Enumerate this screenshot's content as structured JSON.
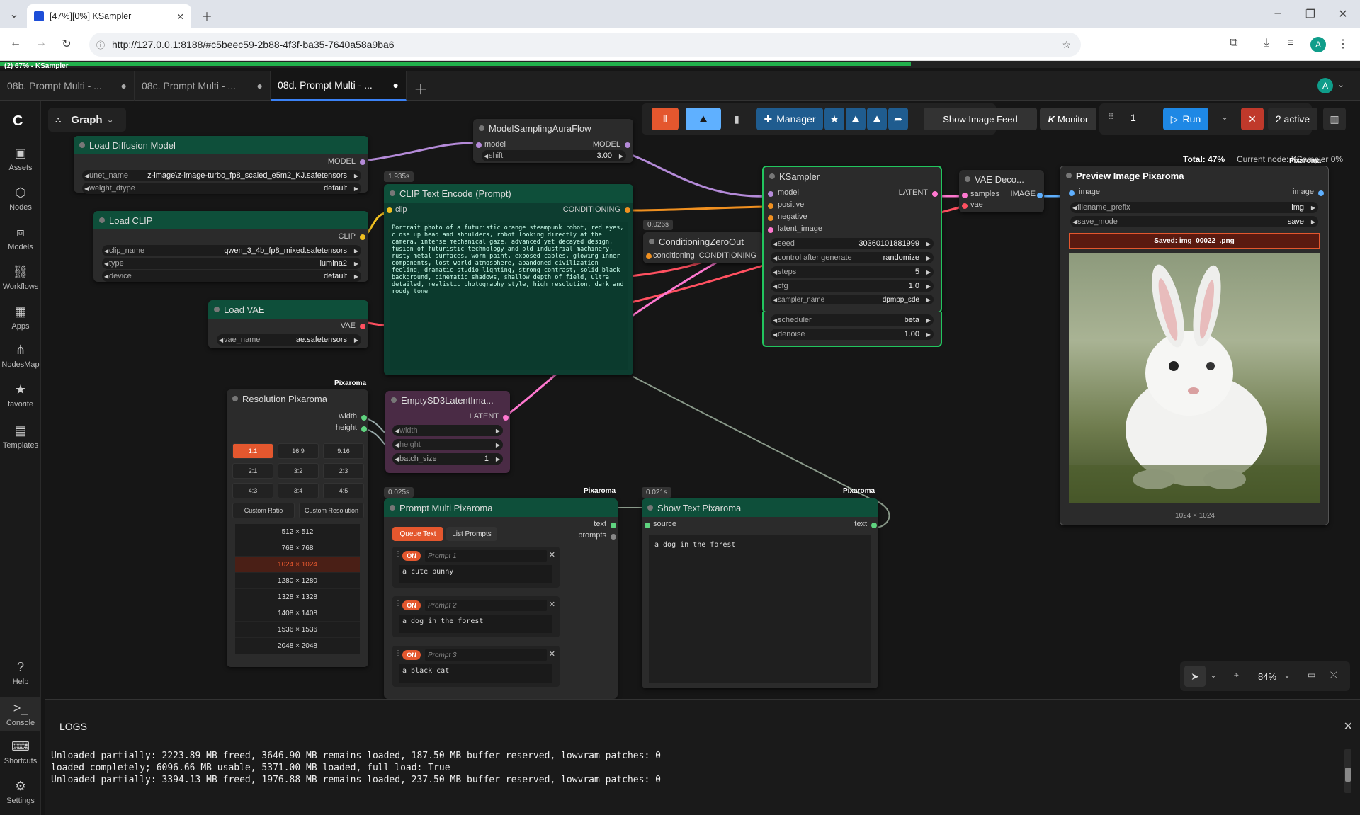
{
  "browser": {
    "tab_title": "[47%][0%] KSampler",
    "url": "http://127.0.0.1:8188/#c5beec59-2b88-4f3f-ba35-7640a58a9ba6",
    "profile_initial": "A"
  },
  "progress": {
    "label": "(2) 67% - KSampler",
    "fraction": 0.67
  },
  "workflow_tabs": [
    {
      "label": "08b. Prompt Multi - ...",
      "active": false
    },
    {
      "label": "08c. Prompt Multi - ...",
      "active": false
    },
    {
      "label": "08d. Prompt Multi - ...",
      "active": true
    }
  ],
  "sidebar": {
    "items": [
      {
        "label": "Assets",
        "icon": "assets-icon"
      },
      {
        "label": "Nodes",
        "icon": "nodes-icon"
      },
      {
        "label": "Models",
        "icon": "models-icon"
      },
      {
        "label": "Workflows",
        "icon": "workflows-icon"
      },
      {
        "label": "Apps",
        "icon": "apps-icon"
      },
      {
        "label": "NodesMap",
        "icon": "nodesmap-icon"
      },
      {
        "label": "favorite",
        "icon": "star-icon"
      },
      {
        "label": "Templates",
        "icon": "templates-icon"
      }
    ],
    "bottom": [
      {
        "label": "Help",
        "icon": "help-icon"
      },
      {
        "label": "Console",
        "icon": "console-icon"
      },
      {
        "label": "Shortcuts",
        "icon": "keyboard-icon"
      },
      {
        "label": "Settings",
        "icon": "gear-icon"
      }
    ]
  },
  "graph_menu": {
    "label": "Graph"
  },
  "toolbar": {
    "manager": "Manager",
    "show_feed": "Show Image Feed",
    "monitor": "Monitor",
    "queue_count": "1",
    "run": "Run",
    "active": "2 active",
    "total": "Total: 47%",
    "current": "Current node: KSampler 0%",
    "user_initial": "A"
  },
  "nodes": {
    "load_diffusion": {
      "title": "Load Diffusion Model",
      "out": "MODEL",
      "unet_label": "unet_name",
      "unet_value": "z-image\\z-image-turbo_fp8_scaled_e5m2_KJ.safetensors",
      "dtype_label": "weight_dtype",
      "dtype_value": "default"
    },
    "load_clip": {
      "title": "Load CLIP",
      "out": "CLIP",
      "clip_label": "clip_name",
      "clip_value": "qwen_3_4b_fp8_mixed.safetensors",
      "type_label": "type",
      "type_value": "lumina2",
      "device_label": "device",
      "device_value": "default"
    },
    "load_vae": {
      "title": "Load VAE",
      "out": "VAE",
      "vae_label": "vae_name",
      "vae_value": "ae.safetensors"
    },
    "model_sampling": {
      "title": "ModelSamplingAuraFlow",
      "in": "model",
      "out": "MODEL",
      "shift_label": "shift",
      "shift_value": "3.00"
    },
    "clip_encode": {
      "title": "CLIP Text Encode (Prompt)",
      "timing": "1.935s",
      "in": "clip",
      "out": "CONDITIONING",
      "text": "Portrait photo of a futuristic orange steampunk robot, red eyes, close up head and shoulders, robot looking directly at the camera, intense mechanical gaze, advanced yet decayed design, fusion of futuristic technology and old industrial machinery, rusty metal surfaces, worn paint, exposed cables, glowing inner components, lost world atmosphere, abandoned civilization feeling, dramatic studio lighting, strong contrast, solid black background, cinematic shadows, shallow depth of field, ultra detailed, realistic photography style, high resolution, dark and moody tone"
    },
    "cond_zero": {
      "title": "ConditioningZeroOut",
      "timing": "0.026s",
      "in": "conditioning",
      "out": "CONDITIONING"
    },
    "ksampler": {
      "title": "KSampler",
      "inputs": [
        "model",
        "positive",
        "negative",
        "latent_image"
      ],
      "out": "LATENT",
      "widgets": [
        {
          "label": "seed",
          "value": "30360101881999"
        },
        {
          "label": "control after generate",
          "value": "randomize"
        },
        {
          "label": "steps",
          "value": "5"
        },
        {
          "label": "cfg",
          "value": "1.0"
        },
        {
          "label": "sampler_name",
          "value": "dpmpp_sde"
        },
        {
          "label": "scheduler",
          "value": "beta"
        },
        {
          "label": "denoise",
          "value": "1.00"
        }
      ]
    },
    "vae_decode": {
      "title": "VAE Deco...",
      "in1": "samples",
      "in2": "vae",
      "out": "IMAGE"
    },
    "preview": {
      "title": "Preview Image Pixaroma",
      "badge": "Pixaroma",
      "in": "image",
      "out": "image",
      "prefix_label": "filename_prefix",
      "prefix_value": "img",
      "save_label": "save_mode",
      "save_value": "save",
      "saved": "Saved: img_00022_.png",
      "dims": "1024 × 1024"
    },
    "resolution": {
      "title": "Resolution Pixaroma",
      "badge": "Pixaroma",
      "out1": "width",
      "out2": "height",
      "ratios": [
        "1:1",
        "16:9",
        "9:16",
        "2:1",
        "3:2",
        "2:3",
        "4:3",
        "3:4",
        "4:5"
      ],
      "custom_ratio": "Custom Ratio",
      "custom_res": "Custom Resolution",
      "sizes": [
        "512 × 512",
        "768 × 768",
        "1024 × 1024",
        "1280 × 1280",
        "1328 × 1328",
        "1408 × 1408",
        "1536 × 1536",
        "2048 × 2048"
      ],
      "selected_size": "1024 × 1024"
    },
    "empty_latent": {
      "title": "EmptySD3LatentIma...",
      "out": "LATENT",
      "w": "width",
      "h": "height",
      "batch_label": "batch_size",
      "batch_value": "1"
    },
    "prompt_multi": {
      "title": "Prompt Multi Pixaroma",
      "badge": "Pixaroma",
      "timing": "0.025s",
      "out1": "text",
      "out2": "prompts",
      "queue": "Queue Text",
      "list": "List Prompts",
      "prompts": [
        {
          "on": "ON",
          "name": "Prompt 1",
          "text": "a cute bunny"
        },
        {
          "on": "ON",
          "name": "Prompt 2",
          "text": "a dog in the forest"
        },
        {
          "on": "ON",
          "name": "Prompt 3",
          "text": "a black cat"
        }
      ]
    },
    "show_text": {
      "title": "Show Text Pixaroma",
      "badge": "Pixaroma",
      "timing": "0.021s",
      "in": "source",
      "out": "text",
      "text": "a dog in the forest"
    }
  },
  "zoom": "84%",
  "logs": {
    "title": "LOGS",
    "lines": [
      "Unloaded partially: 2223.89 MB freed, 3646.90 MB remains loaded, 187.50 MB buffer reserved, lowvram patches: 0",
      "loaded completely; 6096.66 MB usable, 5371.00 MB loaded, full load: True",
      "Unloaded partially: 3394.13 MB freed, 1976.88 MB remains loaded, 237.50 MB buffer reserved, lowvram patches: 0"
    ]
  }
}
